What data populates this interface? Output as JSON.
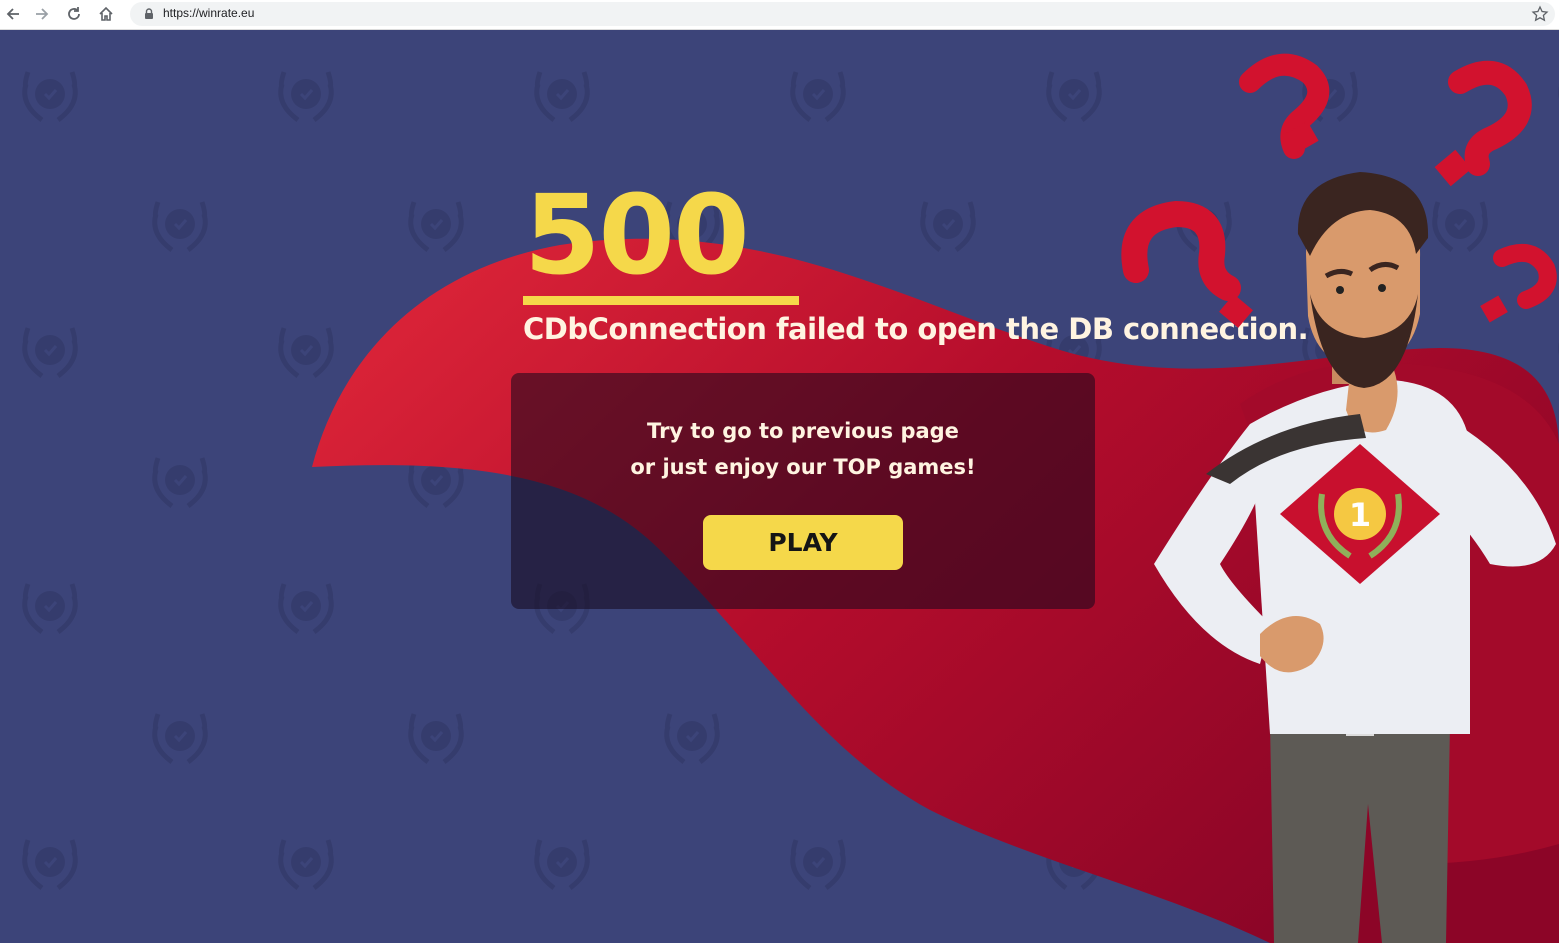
{
  "browser": {
    "url": "https://winrate.eu"
  },
  "error": {
    "code": "500",
    "message": "CDbConnection failed to open the DB connection."
  },
  "panel": {
    "line1": "Try to go to previous page",
    "line2": "or just enjoy our TOP games!",
    "play_label": "PLAY"
  },
  "hero": {
    "badge_number": "1"
  },
  "colors": {
    "background": "#3c4479",
    "accent_yellow": "#f5d84a",
    "cape_red": "#c8102e",
    "text_cream": "#fff4e1"
  },
  "icons": {
    "back": "back-arrow-icon",
    "forward": "forward-arrow-icon",
    "reload": "reload-icon",
    "home": "home-icon",
    "lock": "lock-icon",
    "bookmark": "star-icon"
  }
}
